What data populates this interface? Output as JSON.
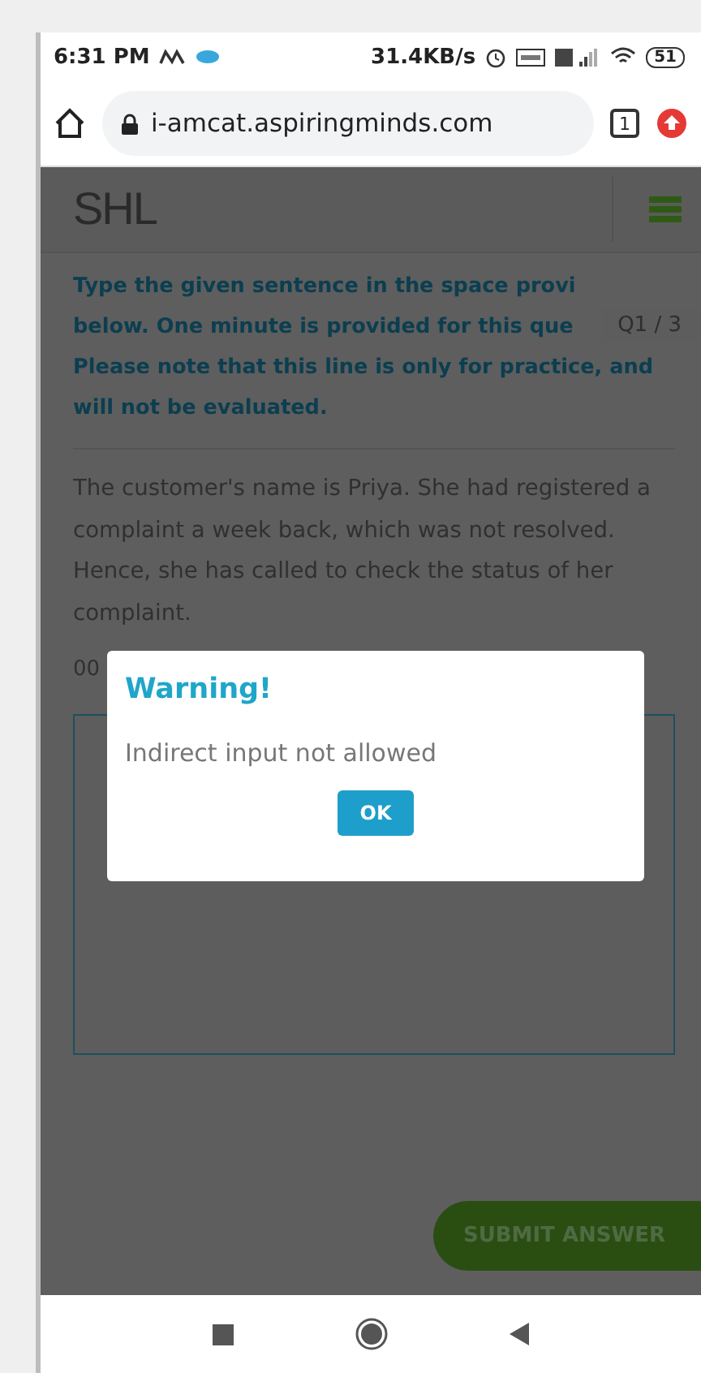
{
  "status_bar": {
    "time": "6:31 PM",
    "speed": "31.4KB/s",
    "battery": "51"
  },
  "browser": {
    "url": "i-amcat.aspiringminds.com",
    "tab_count": "1"
  },
  "header": {
    "logo": "SHL"
  },
  "question": {
    "counter": "Q1 / 3",
    "instructions": [
      "Type the given sentence in the space provi",
      "below. One minute is provided for this que",
      "Please note that this line is only for practice, and",
      "will not be evaluated."
    ],
    "passage": "The customer's name is Priya. She had registered a complaint a week back, which was not resolved. Hence, she has called to check the status of her complaint.",
    "timer": "00"
  },
  "submit_button": {
    "label": "SUBMIT ANSWER"
  },
  "dialog": {
    "title": "Warning!",
    "message": "Indirect input not allowed",
    "button": "OK"
  }
}
